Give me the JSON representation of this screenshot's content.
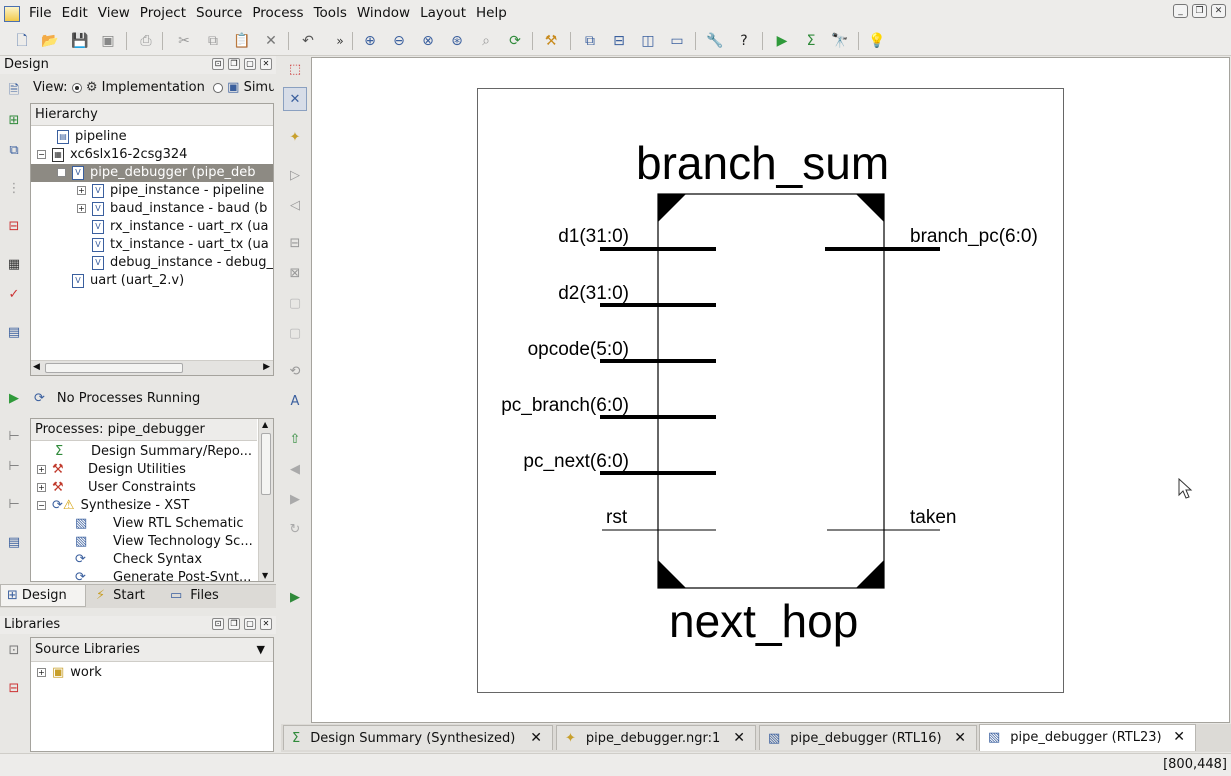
{
  "menu": [
    "File",
    "Edit",
    "View",
    "Project",
    "Source",
    "Process",
    "Tools",
    "Window",
    "Layout",
    "Help"
  ],
  "design_panel": {
    "title": "Design",
    "view_label": "View:",
    "view_options": [
      "Implementation",
      "Simulation"
    ],
    "view_selected": "Implementation",
    "hierarchy_header": "Hierarchy",
    "tree": [
      {
        "label": "pipeline",
        "icon": "project-icon"
      },
      {
        "label": "xc6slx16-2csg324",
        "icon": "chip-icon"
      },
      {
        "label": "pipe_debugger (pipe_deb",
        "icon": "verilog-icon",
        "selected": true
      },
      {
        "label": "pipe_instance - pipeline",
        "icon": "verilog-icon"
      },
      {
        "label": "baud_instance - baud (b",
        "icon": "verilog-icon"
      },
      {
        "label": "rx_instance - uart_rx (ua",
        "icon": "verilog-icon"
      },
      {
        "label": "tx_instance - uart_tx (ua",
        "icon": "verilog-icon"
      },
      {
        "label": "debug_instance - debug_",
        "icon": "verilog-icon"
      },
      {
        "label": "uart (uart_2.v)",
        "icon": "verilog-icon"
      }
    ],
    "status": "No Processes Running",
    "processes_header": "Processes: pipe_debugger",
    "processes": [
      {
        "label": "Design Summary/Repo...",
        "icon": "sigma-icon"
      },
      {
        "label": "Design Utilities",
        "icon": "tools-icon"
      },
      {
        "label": "User Constraints",
        "icon": "tools-icon"
      },
      {
        "label": "Synthesize - XST",
        "icon": "warning-icon"
      },
      {
        "label": "View RTL Schematic",
        "icon": "schematic-icon"
      },
      {
        "label": "View Technology Sc...",
        "icon": "schematic-icon"
      },
      {
        "label": "Check Syntax",
        "icon": "refresh-icon"
      },
      {
        "label": "Generate Post-Synt...",
        "icon": "refresh-icon"
      }
    ],
    "bottom_tabs": [
      "Design",
      "Start",
      "Files"
    ]
  },
  "libraries_panel": {
    "title": "Libraries",
    "dropdown": "Source Libraries",
    "items": [
      "work"
    ]
  },
  "schematic": {
    "title_top": "branch_sum",
    "title_bottom": "next_hop",
    "inputs": [
      "d1(31:0)",
      "d2(31:0)",
      "opcode(5:0)",
      "pc_branch(6:0)",
      "pc_next(6:0)",
      "rst"
    ],
    "outputs": [
      "branch_pc(6:0)",
      "taken"
    ]
  },
  "doc_tabs": [
    "Design Summary (Synthesized)",
    "pipe_debugger.ngr:1",
    "pipe_debugger (RTL16)",
    "pipe_debugger (RTL23)"
  ],
  "status_bar": {
    "coords": "[800,448]"
  }
}
